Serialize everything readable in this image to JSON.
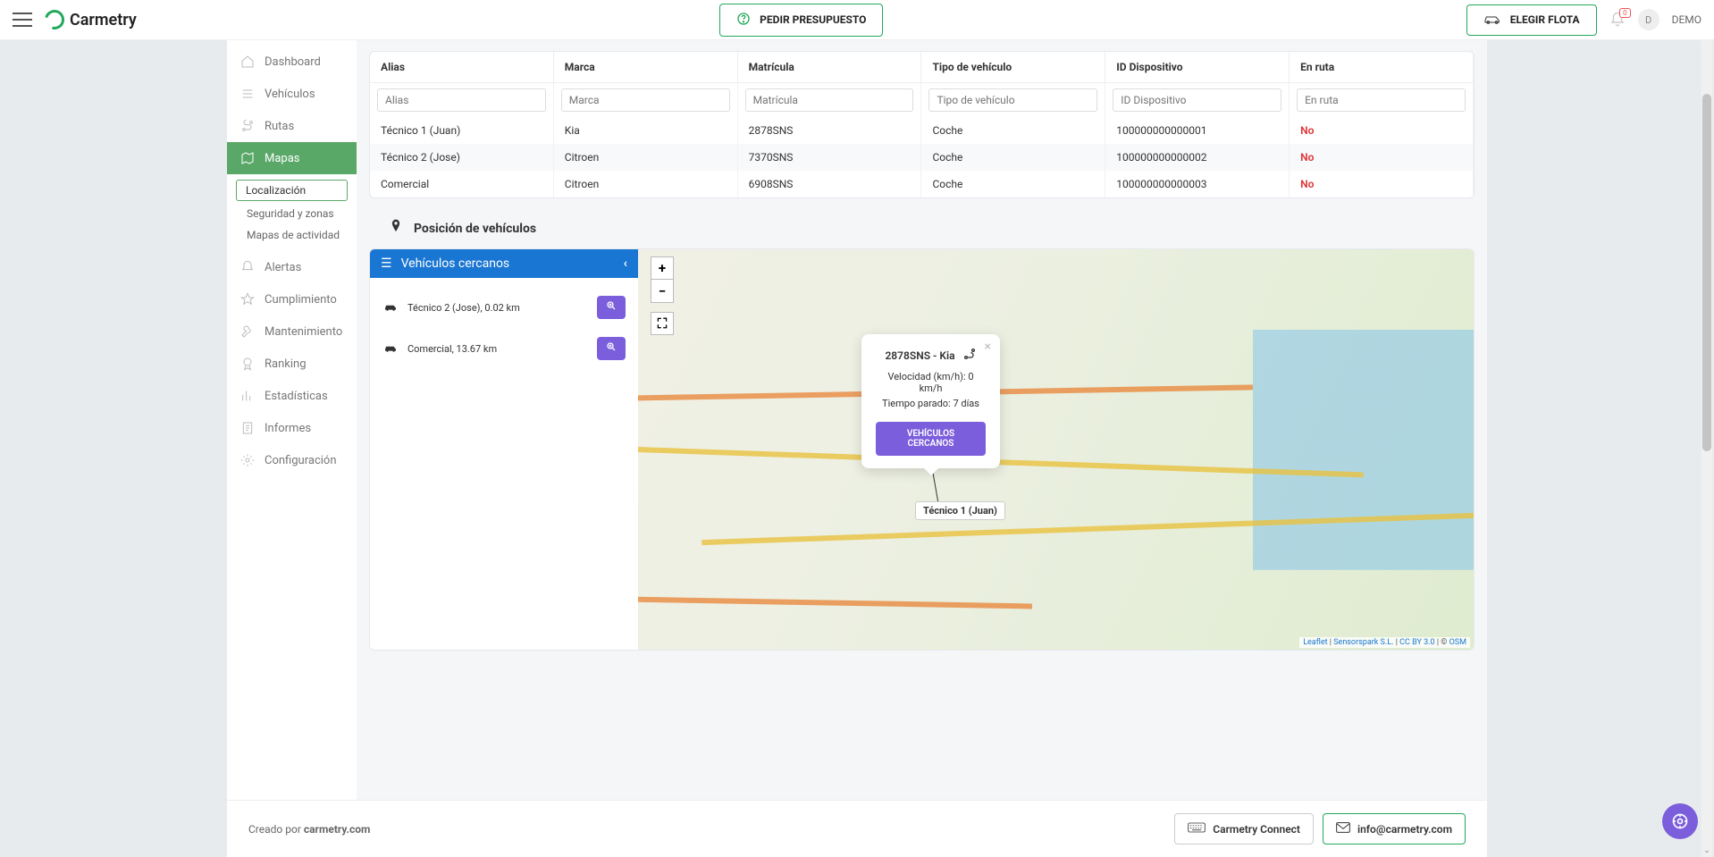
{
  "brand": "Carmetry",
  "header": {
    "quote_btn": "PEDIR PRESUPUESTO",
    "fleet_btn": "ELEGIR FLOTA",
    "notif_count": "0",
    "user_initial": "D",
    "user_name": "DEMO"
  },
  "sidebar": {
    "items": [
      {
        "key": "dashboard",
        "label": "Dashboard"
      },
      {
        "key": "vehiculos",
        "label": "Vehículos"
      },
      {
        "key": "rutas",
        "label": "Rutas"
      },
      {
        "key": "mapas",
        "label": "Mapas"
      },
      {
        "key": "alertas",
        "label": "Alertas"
      },
      {
        "key": "cumplimiento",
        "label": "Cumplimiento"
      },
      {
        "key": "mantenimiento",
        "label": "Mantenimiento"
      },
      {
        "key": "ranking",
        "label": "Ranking"
      },
      {
        "key": "estadisticas",
        "label": "Estadísticas"
      },
      {
        "key": "informes",
        "label": "Informes"
      },
      {
        "key": "configuracion",
        "label": "Configuración"
      }
    ],
    "sub": {
      "localizacion": "Localización",
      "seguridad": "Seguridad y zonas",
      "actividad": "Mapas de actividad"
    }
  },
  "table": {
    "headers": {
      "alias": "Alias",
      "marca": "Marca",
      "matricula": "Matrícula",
      "tipo": "Tipo de vehículo",
      "id": "ID Dispositivo",
      "ruta": "En ruta"
    },
    "placeholders": {
      "alias": "Alias",
      "marca": "Marca",
      "matricula": "Matrícula",
      "tipo": "Tipo de vehículo",
      "id": "ID Dispositivo",
      "ruta": "En ruta"
    },
    "rows": [
      {
        "alias": "Técnico 1 (Juan)",
        "marca": "Kia",
        "matricula": "2878SNS",
        "tipo": "Coche",
        "id": "100000000000001",
        "ruta": "No"
      },
      {
        "alias": "Técnico 2 (Jose)",
        "marca": "Citroen",
        "matricula": "7370SNS",
        "tipo": "Coche",
        "id": "100000000000002",
        "ruta": "No"
      },
      {
        "alias": "Comercial",
        "marca": "Citroen",
        "matricula": "6908SNS",
        "tipo": "Coche",
        "id": "100000000000003",
        "ruta": "No"
      }
    ]
  },
  "section_title": "Posición de vehículos",
  "nearby": {
    "title": "Vehículos cercanos",
    "items": [
      {
        "label": "Técnico 2 (Jose), 0.02 km"
      },
      {
        "label": "Comercial, 13.67 km"
      }
    ]
  },
  "popup": {
    "title": "2878SNS - Kia",
    "speed": "Velocidad (km/h): 0 km/h",
    "stopped": "Tiempo parado: 7 días",
    "btn": "VEHÍCULOS CERCANOS"
  },
  "marker_label": "Técnico 1 (Juan)",
  "attrib": {
    "leaflet": "Leaflet",
    "sensor": "Sensorspark S.L.",
    "cc": "CC BY 3.0",
    "osm": "OSM"
  },
  "footer": {
    "created_by": "Creado por ",
    "created_link": "carmetry.com",
    "connect": "Carmetry Connect",
    "email": "info@carmetry.com"
  }
}
